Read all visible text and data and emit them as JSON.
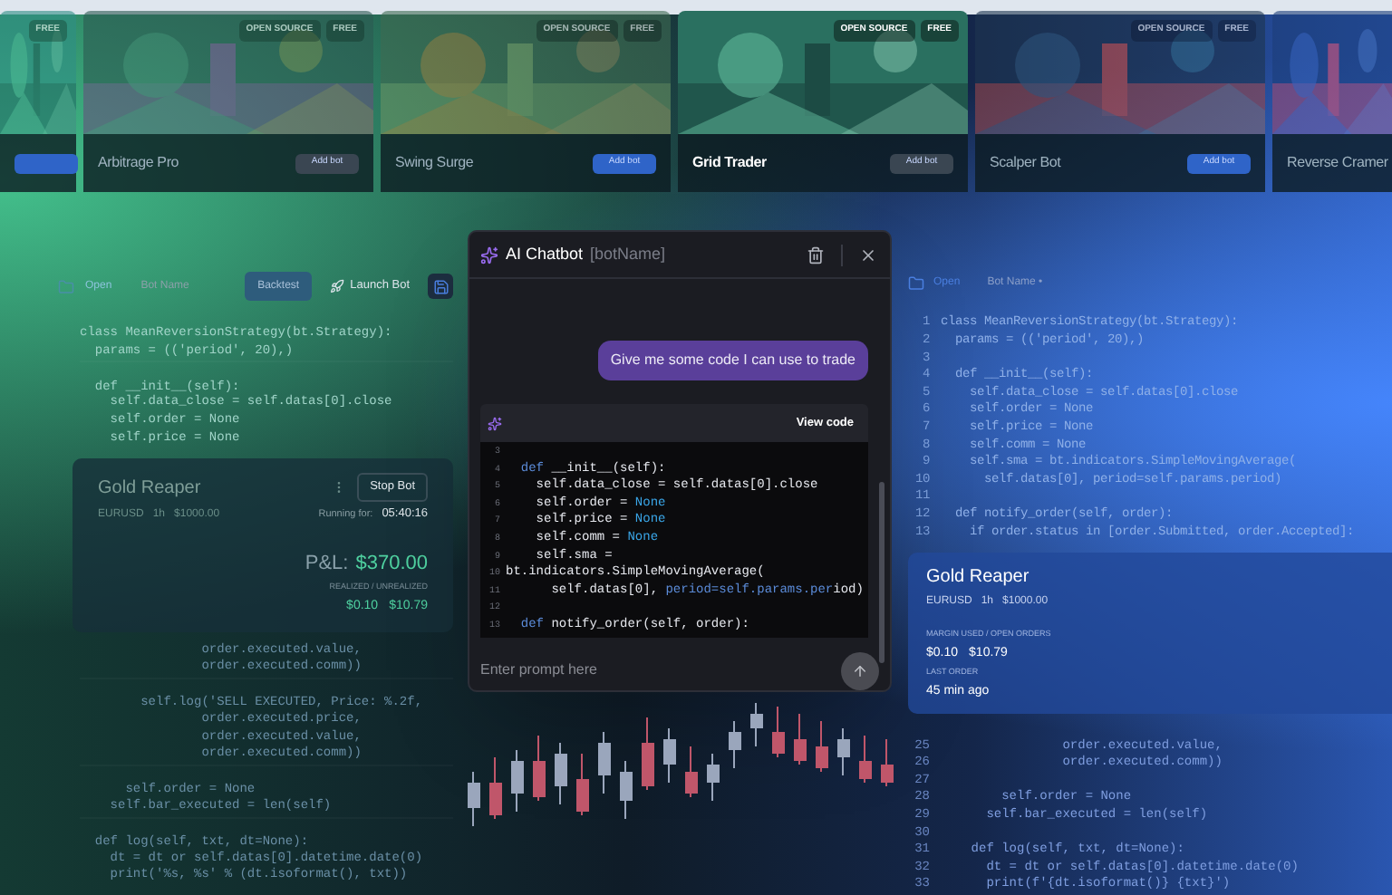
{
  "cards": [
    {
      "selected": false,
      "badges": [
        "FREE"
      ],
      "button": {
        "kind": "primary"
      }
    },
    {
      "selected": false,
      "title": "Arbitrage Pro",
      "badges": [
        "OPEN SOURCE",
        "FREE"
      ],
      "button": {
        "kind": "muted",
        "label": "Add bot"
      }
    },
    {
      "selected": false,
      "title": "Swing Surge",
      "badges": [
        "OPEN SOURCE",
        "FREE"
      ],
      "button": {
        "kind": "primary",
        "label": "Add bot"
      }
    },
    {
      "selected": true,
      "title": "Grid Trader",
      "badges": [
        "OPEN SOURCE",
        "FREE"
      ],
      "button": {
        "kind": "muted",
        "label": "Add bot"
      }
    },
    {
      "selected": false,
      "title": "Scalper Bot",
      "badges": [
        "OPEN SOURCE",
        "FREE"
      ],
      "button": {
        "kind": "primary",
        "label": "Add bot"
      }
    },
    {
      "selected": false,
      "title": "Reverse Cramer"
    }
  ],
  "left_editor": {
    "toolbar": {
      "open": "Open",
      "bot_name": "Bot Name",
      "backtest": "Backtest",
      "launch": "Launch Bot"
    },
    "code_top": [
      {
        "code": "class MeanReversionStrategy(bt.Strategy):"
      },
      {
        "code": "  params = (('period', 20),)"
      },
      {
        "code": "  def __init__(self):",
        "gap_before": true
      },
      {
        "code": "    self.data_close = self.datas[0].close"
      },
      {
        "code": "    self.order = None"
      },
      {
        "code": "    self.price = None"
      }
    ],
    "bot": {
      "name": "Gold Reaper",
      "pair": "EURUSD",
      "timeframe": "1h",
      "amount": "$1000.00",
      "stop": "Stop Bot",
      "running_label": "Running for:",
      "running": "05:40:16",
      "pnl_label": "P&L:",
      "pnl": "$370.00",
      "realized_label": "REALIZED / UNREALIZED",
      "realized": "$0.10",
      "unrealized": "$10.79"
    },
    "code_bottom": [
      {
        "code": "                order.executed.value,"
      },
      {
        "code": "                order.executed.comm))"
      },
      {
        "code": "        self.log('SELL EXECUTED, Price: %.2f,",
        "gap_before": true
      },
      {
        "code": "                order.executed.price,"
      },
      {
        "code": "                order.executed.value,"
      },
      {
        "code": "                order.executed.comm))"
      },
      {
        "code": "      self.order = None",
        "gap_before": true
      },
      {
        "code": "    self.bar_executed = len(self)"
      },
      {
        "code": "  def log(self, txt, dt=None):",
        "gap_before": true
      },
      {
        "code": "    dt = dt or self.datas[0].datetime.date(0)"
      },
      {
        "code": "    print('%s, %s' % (dt.isoformat(), txt))"
      }
    ]
  },
  "chatbot": {
    "title": "AI Chatbot",
    "subtitle": "[botName]",
    "user_message": "Give me some code I can use to trade",
    "view_code": "View code",
    "code": [
      {
        "num": "3"
      },
      {
        "num": "4",
        "segs": [
          {
            "t": "  def ",
            "kind": "keyword"
          },
          {
            "t": "__init__(self):",
            "kind": "plain"
          }
        ]
      },
      {
        "num": "5",
        "segs": [
          {
            "t": "    self.data_close = self.datas[0].close",
            "kind": "plain"
          }
        ]
      },
      {
        "num": "6",
        "segs": [
          {
            "t": "    self.order = ",
            "kind": "plain"
          },
          {
            "t": "None",
            "kind": "value"
          }
        ]
      },
      {
        "num": "7",
        "segs": [
          {
            "t": "    self.price = ",
            "kind": "plain"
          },
          {
            "t": "None",
            "kind": "value"
          }
        ]
      },
      {
        "num": "8",
        "segs": [
          {
            "t": "    self.comm = ",
            "kind": "plain"
          },
          {
            "t": "None",
            "kind": "value"
          }
        ]
      },
      {
        "num": "9",
        "segs": [
          {
            "t": "    self.sma =",
            "kind": "plain"
          }
        ]
      },
      {
        "num": "10",
        "segs": [
          {
            "t": "bt.indicators.SimpleMovingAverage(",
            "kind": "plain"
          }
        ]
      },
      {
        "num": "11",
        "segs": [
          {
            "t": "      self.datas[0], ",
            "kind": "plain"
          },
          {
            "t": "period=self.params.per",
            "kind": "keyword"
          },
          {
            "t": "iod)",
            "kind": "plain"
          }
        ]
      },
      {
        "num": "12"
      },
      {
        "num": "13",
        "segs": [
          {
            "t": "  def ",
            "kind": "keyword"
          },
          {
            "t": "notify_order(self, order):",
            "kind": "plain"
          }
        ]
      }
    ],
    "input_placeholder": "Enter prompt here"
  },
  "right_editor": {
    "toolbar": {
      "open": "Open",
      "bot_name": "Bot Name •"
    },
    "code_top": [
      {
        "num": "1",
        "code": "class MeanReversionStrategy(bt.Strategy):"
      },
      {
        "num": "2",
        "code": "  params = (('period', 20),)"
      },
      {
        "num": "3"
      },
      {
        "num": "4",
        "code": "  def __init__(self):"
      },
      {
        "num": "5",
        "code": "    self.data_close = self.datas[0].close"
      },
      {
        "num": "6",
        "code": "    self.order = None"
      },
      {
        "num": "7",
        "code": "    self.price = None"
      },
      {
        "num": "8",
        "code": "    self.comm = None"
      },
      {
        "num": "9",
        "code": "    self.sma = bt.indicators.SimpleMovingAverage("
      },
      {
        "num": "10",
        "code": "      self.datas[0], period=self.params.period)"
      },
      {
        "num": "11"
      },
      {
        "num": "12",
        "code": "  def notify_order(self, order):"
      },
      {
        "num": "13",
        "code": "    if order.status in [order.Submitted, order.Accepted]:"
      }
    ],
    "bot": {
      "name": "Gold Reaper",
      "pair": "EURUSD",
      "timeframe": "1h",
      "amount": "$1000.00",
      "margin_label": "MARGIN USED / OPEN ORDERS",
      "margin": "$0.10",
      "orders": "$10.79",
      "last_label": "LAST ORDER",
      "last": "45 min ago"
    },
    "code_bottom": [
      {
        "num": "25",
        "code": "                order.executed.value,"
      },
      {
        "num": "26",
        "code": "                order.executed.comm))"
      },
      {
        "num": "27"
      },
      {
        "num": "28",
        "code": "        self.order = None"
      },
      {
        "num": "29",
        "code": "      self.bar_executed = len(self)"
      },
      {
        "num": "30"
      },
      {
        "num": "31",
        "code": "    def log(self, txt, dt=None):"
      },
      {
        "num": "32",
        "code": "      dt = dt or self.datas[0].datetime.date(0)"
      },
      {
        "num": "33",
        "code": "      print(f'{dt.isoformat()} {txt}')"
      }
    ]
  }
}
